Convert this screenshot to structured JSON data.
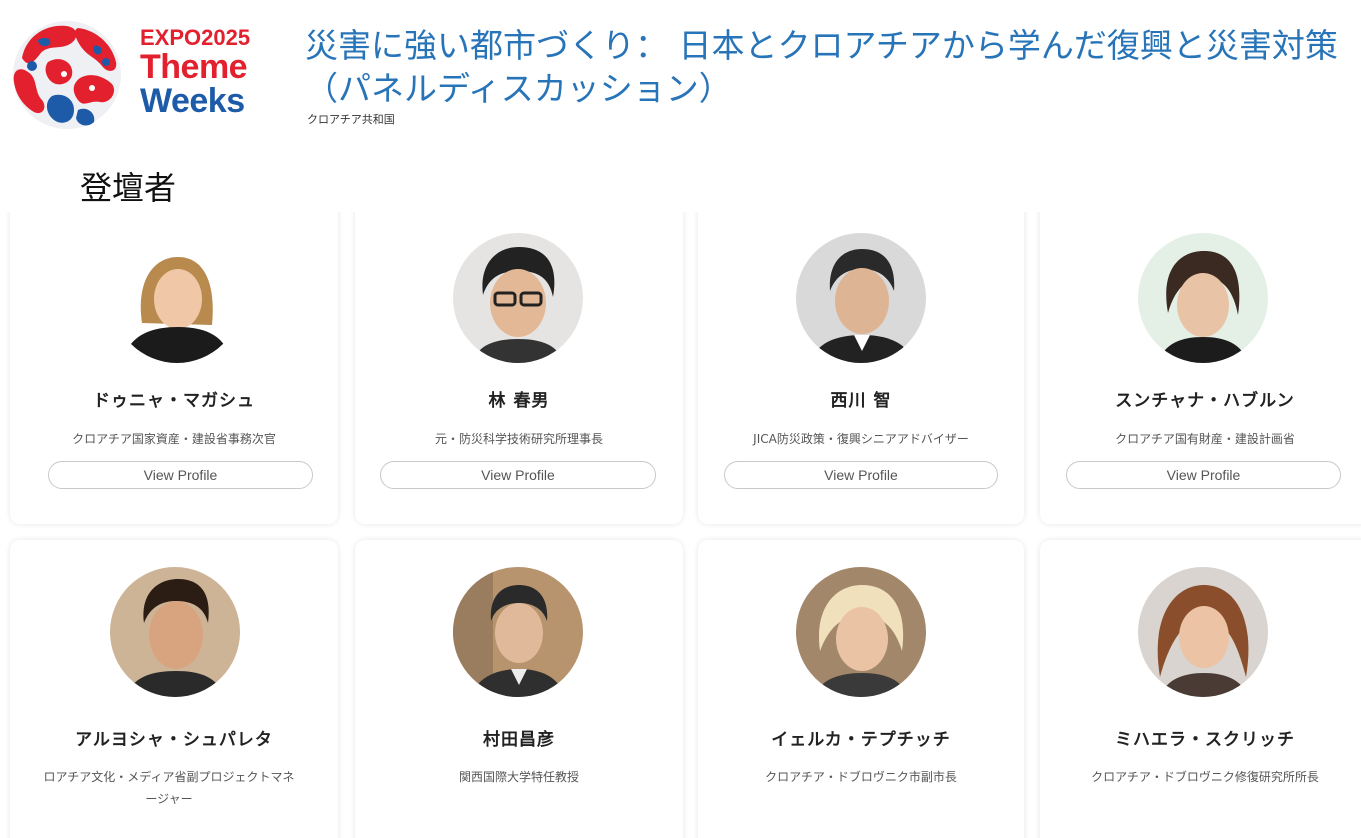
{
  "logo": {
    "expo": "EXPO2025",
    "theme": "Theme",
    "weeks": "Weeks"
  },
  "event": {
    "title": "災害に強い都市づくり： 日本とクロアチアから学んだ復興と災害対策（パネルディスカッション）",
    "country": "クロアチア共和国"
  },
  "section_title": "登壇者",
  "profile_button_label": "View Profile",
  "speakers": [
    {
      "name": "ドゥニャ・マガシュ",
      "role": "クロアチア国家資産・建設省事務次官"
    },
    {
      "name": "林 春男",
      "role": "元・防災科学技術研究所理事長"
    },
    {
      "name": "西川 智",
      "role": "JICA防災政策・復興シニアアドバイザー"
    },
    {
      "name": "スンチャナ・ハブルン",
      "role": "クロアチア国有財産・建設計画省"
    },
    {
      "name": "アルヨシャ・シュパレタ",
      "role": "ロアチア文化・メディア省副プロジェクトマネージャー"
    },
    {
      "name": "村田昌彦",
      "role": "関西国際大学特任教授"
    },
    {
      "name": "イェルカ・テプチッチ",
      "role": "クロアチア・ドブロヴニク市副市長"
    },
    {
      "name": "ミハエラ・スクリッチ",
      "role": "クロアチア・ドブロヴニク修復研究所所長"
    }
  ],
  "colors": {
    "title_blue": "#2874b8",
    "logo_red": "#e3202e",
    "logo_blue": "#1d5aa8"
  }
}
